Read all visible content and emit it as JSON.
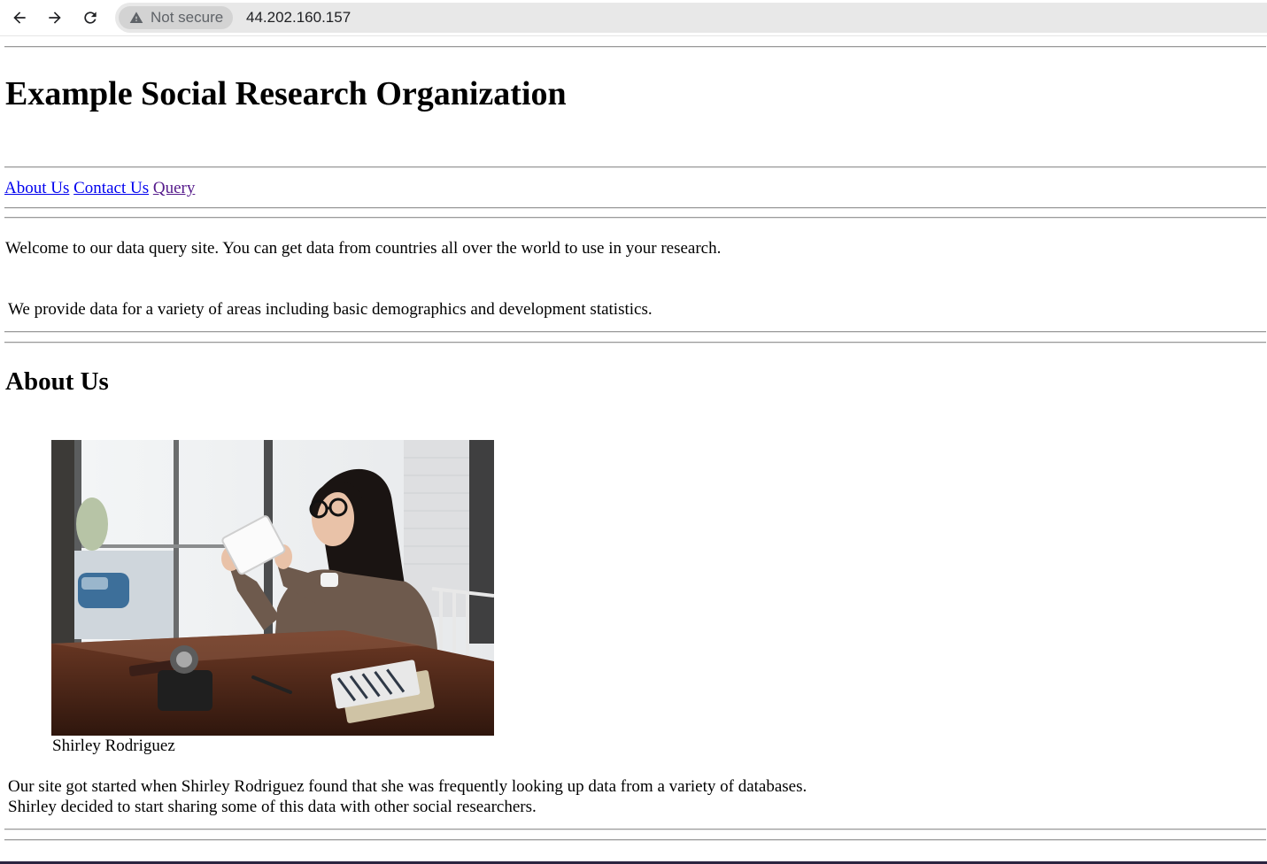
{
  "browser": {
    "security_label": "Not secure",
    "url": "44.202.160.157",
    "icons": [
      "back-arrow-icon",
      "forward-arrow-icon",
      "reload-icon",
      "warning-triangle-icon"
    ]
  },
  "site": {
    "title": "Example Social Research Organization"
  },
  "nav": {
    "about": "About Us",
    "contact": "Contact Us",
    "query": "Query"
  },
  "intro": {
    "welcome": "Welcome to our data query site. You can get data from countries all over the world to use in your research.",
    "provide": "We provide data for a variety of areas including basic demographics and development statistics."
  },
  "about": {
    "heading": "About Us",
    "caption": "Shirley Rodriguez",
    "line1": "Our site got started when Shirley Rodriguez found that she was frequently looking up data from a variety of databases.",
    "line2": "Shirley decided to start sharing some of this data with other social researchers."
  },
  "colors": {
    "link": "#0000ee",
    "visited_link": "#551a8b",
    "omnibox_bg": "#e8e8e8"
  }
}
